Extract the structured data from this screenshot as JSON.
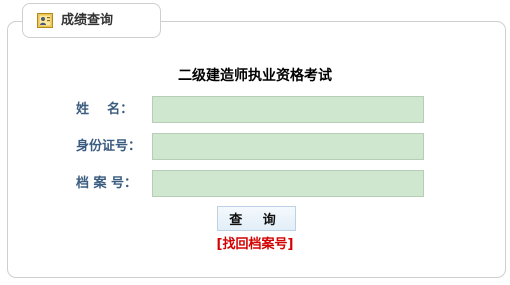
{
  "tab": {
    "icon": "id-card-icon",
    "title": "成绩查询"
  },
  "form": {
    "title": "二级建造师执业资格考试",
    "fields": [
      {
        "label": "姓    名：",
        "value": "",
        "placeholder": ""
      },
      {
        "label": "身份证号：",
        "value": "",
        "placeholder": ""
      },
      {
        "label": "档 案 号：",
        "value": "",
        "placeholder": ""
      }
    ],
    "query_button": "查 询",
    "retrieve_link": "[找回档案号]"
  },
  "colors": {
    "label": "#3a5c7f",
    "input_bg": "#cfe7cf",
    "link": "#d40000"
  }
}
